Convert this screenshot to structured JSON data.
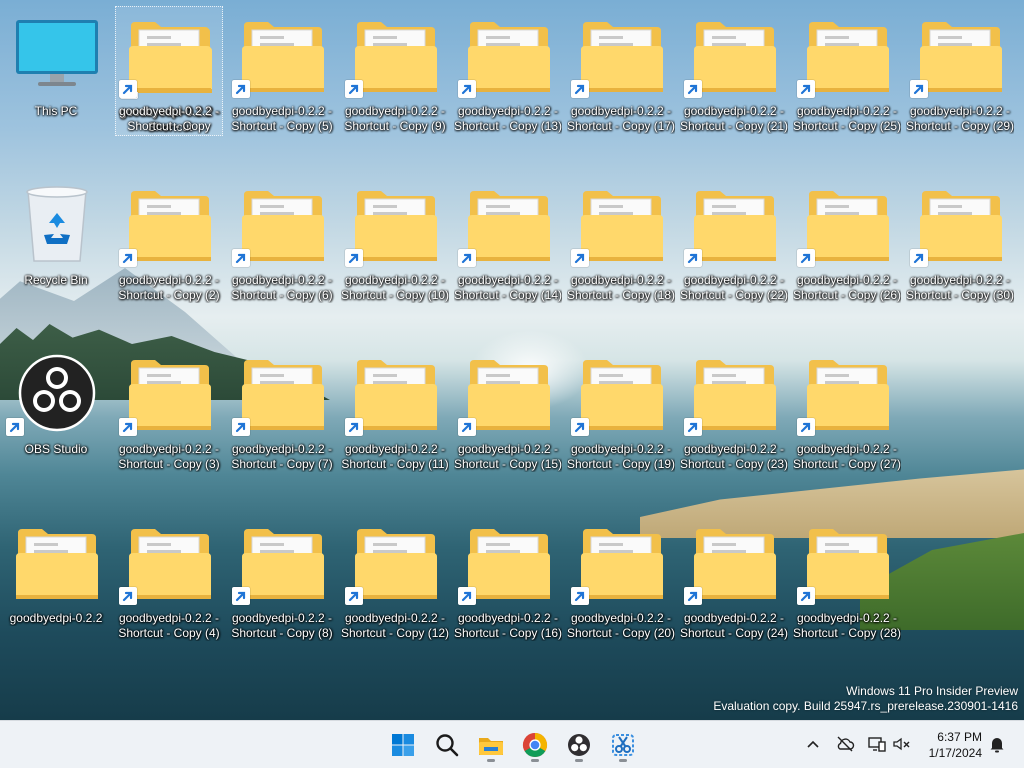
{
  "desktop": {
    "icons": [
      {
        "id": "this-pc",
        "line1": "This PC",
        "line2": "",
        "type": "pc"
      },
      {
        "id": "recycle-bin",
        "line1": "Recycle Bin",
        "line2": "",
        "type": "bin"
      },
      {
        "id": "obs",
        "line1": "OBS Studio",
        "line2": "",
        "type": "obs",
        "shortcut": true
      },
      {
        "id": "gbd",
        "line1": "goodbyedpi-0.2.2",
        "line2": "",
        "type": "folder"
      },
      {
        "id": "c0",
        "line1": "goodbyedpi-0.2.2 -",
        "line2": "Shortcut",
        "type": "folder",
        "shortcut": true,
        "selected": true
      },
      {
        "id": "c1",
        "line1": "goodbyedpi-0.2.2 -",
        "line2": "Shortcut - Copy",
        "type": "folder",
        "shortcut": true
      },
      {
        "id": "c2",
        "line1": "goodbyedpi-0.2.2 -",
        "line2": "Shortcut - Copy (2)",
        "type": "folder",
        "shortcut": true
      },
      {
        "id": "c3",
        "line1": "goodbyedpi-0.2.2 -",
        "line2": "Shortcut - Copy (3)",
        "type": "folder",
        "shortcut": true
      },
      {
        "id": "c4",
        "line1": "goodbyedpi-0.2.2 -",
        "line2": "Shortcut - Copy (4)",
        "type": "folder",
        "shortcut": true
      },
      {
        "id": "c5",
        "line1": "goodbyedpi-0.2.2 -",
        "line2": "Shortcut - Copy (5)",
        "type": "folder",
        "shortcut": true
      },
      {
        "id": "c6",
        "line1": "goodbyedpi-0.2.2 -",
        "line2": "Shortcut - Copy (6)",
        "type": "folder",
        "shortcut": true
      },
      {
        "id": "c7",
        "line1": "goodbyedpi-0.2.2 -",
        "line2": "Shortcut - Copy (7)",
        "type": "folder",
        "shortcut": true
      },
      {
        "id": "c8",
        "line1": "goodbyedpi-0.2.2 -",
        "line2": "Shortcut - Copy (8)",
        "type": "folder",
        "shortcut": true
      },
      {
        "id": "c9",
        "line1": "goodbyedpi-0.2.2 -",
        "line2": "Shortcut - Copy (9)",
        "type": "folder",
        "shortcut": true
      },
      {
        "id": "c10",
        "line1": "goodbyedpi-0.2.2 -",
        "line2": "Shortcut - Copy (10)",
        "type": "folder",
        "shortcut": true
      },
      {
        "id": "c11",
        "line1": "goodbyedpi-0.2.2 -",
        "line2": "Shortcut - Copy (11)",
        "type": "folder",
        "shortcut": true
      },
      {
        "id": "c12",
        "line1": "goodbyedpi-0.2.2 -",
        "line2": "Shortcut - Copy (12)",
        "type": "folder",
        "shortcut": true
      },
      {
        "id": "c13",
        "line1": "goodbyedpi-0.2.2 -",
        "line2": "Shortcut - Copy (13)",
        "type": "folder",
        "shortcut": true
      },
      {
        "id": "c14",
        "line1": "goodbyedpi-0.2.2 -",
        "line2": "Shortcut - Copy (14)",
        "type": "folder",
        "shortcut": true
      },
      {
        "id": "c15",
        "line1": "goodbyedpi-0.2.2 -",
        "line2": "Shortcut - Copy (15)",
        "type": "folder",
        "shortcut": true
      },
      {
        "id": "c16",
        "line1": "goodbyedpi-0.2.2 -",
        "line2": "Shortcut - Copy (16)",
        "type": "folder",
        "shortcut": true
      },
      {
        "id": "c17",
        "line1": "goodbyedpi-0.2.2 -",
        "line2": "Shortcut - Copy (17)",
        "type": "folder",
        "shortcut": true
      },
      {
        "id": "c18",
        "line1": "goodbyedpi-0.2.2 -",
        "line2": "Shortcut - Copy (18)",
        "type": "folder",
        "shortcut": true
      },
      {
        "id": "c19",
        "line1": "goodbyedpi-0.2.2 -",
        "line2": "Shortcut - Copy (19)",
        "type": "folder",
        "shortcut": true
      },
      {
        "id": "c20",
        "line1": "goodbyedpi-0.2.2 -",
        "line2": "Shortcut - Copy (20)",
        "type": "folder",
        "shortcut": true
      },
      {
        "id": "c21",
        "line1": "goodbyedpi-0.2.2 -",
        "line2": "Shortcut - Copy (21)",
        "type": "folder",
        "shortcut": true
      },
      {
        "id": "c22",
        "line1": "goodbyedpi-0.2.2 -",
        "line2": "Shortcut - Copy (22)",
        "type": "folder",
        "shortcut": true
      },
      {
        "id": "c23",
        "line1": "goodbyedpi-0.2.2 -",
        "line2": "Shortcut - Copy (23)",
        "type": "folder",
        "shortcut": true
      },
      {
        "id": "c24",
        "line1": "goodbyedpi-0.2.2 -",
        "line2": "Shortcut - Copy (24)",
        "type": "folder",
        "shortcut": true
      },
      {
        "id": "c25",
        "line1": "goodbyedpi-0.2.2 -",
        "line2": "Shortcut - Copy (25)",
        "type": "folder",
        "shortcut": true
      },
      {
        "id": "c26",
        "line1": "goodbyedpi-0.2.2 -",
        "line2": "Shortcut - Copy (26)",
        "type": "folder",
        "shortcut": true
      },
      {
        "id": "c27",
        "line1": "goodbyedpi-0.2.2 -",
        "line2": "Shortcut - Copy (27)",
        "type": "folder",
        "shortcut": true
      },
      {
        "id": "c28",
        "line1": "goodbyedpi-0.2.2 -",
        "line2": "Shortcut - Copy (28)",
        "type": "folder",
        "shortcut": true
      },
      {
        "id": "c29",
        "line1": "goodbyedpi-0.2.2 -",
        "line2": "Shortcut - Copy (29)",
        "type": "folder",
        "shortcut": true
      },
      {
        "id": "c30",
        "line1": "goodbyedpi-0.2.2 -",
        "line2": "Shortcut - Copy (30)",
        "type": "folder",
        "shortcut": true
      }
    ]
  },
  "watermark": {
    "line1": "Windows 11 Pro Insider Preview",
    "line2": "Evaluation copy. Build 25947.rs_prerelease.230901-1416"
  },
  "taskbar": {
    "apps": [
      {
        "name": "start-button",
        "icon": "windows-logo-icon",
        "running": false
      },
      {
        "name": "search-button",
        "icon": "search-icon",
        "running": false
      },
      {
        "name": "file-explorer-button",
        "icon": "folder-icon",
        "running": true
      },
      {
        "name": "chrome-button",
        "icon": "chrome-icon",
        "running": true
      },
      {
        "name": "obs-button",
        "icon": "obs-icon",
        "running": true
      },
      {
        "name": "snipping-tool-button",
        "icon": "snipping-tool-icon",
        "running": true
      }
    ],
    "clock": {
      "time": "6:37 PM",
      "date": "1/17/2024"
    }
  },
  "colors": {
    "folder_back": "#f2c04a",
    "folder_front": "#ffd86b",
    "accent": "#0067c0",
    "taskbar_bg": "#eef2f6"
  }
}
